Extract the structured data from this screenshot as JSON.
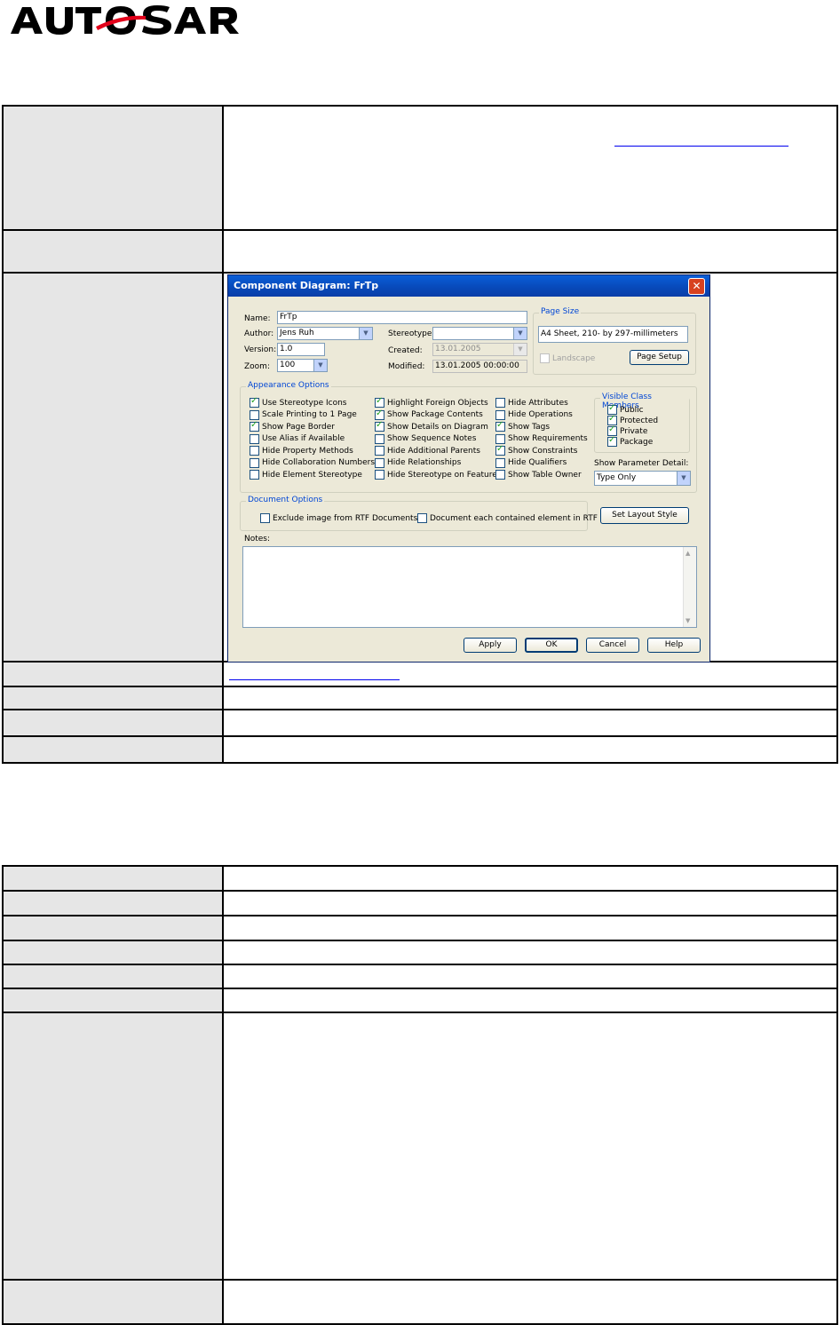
{
  "logo": {
    "text": "AUTOSAR"
  },
  "table1": {
    "row1_link": "",
    "row2_text": "",
    "row4_link": ""
  },
  "dialog": {
    "title": "Component Diagram: FrTp",
    "name_label": "Name:",
    "name_value": "FrTp",
    "author_label": "Author:",
    "author_value": "Jens Ruh",
    "version_label": "Version:",
    "version_value": "1.0",
    "zoom_label": "Zoom:",
    "zoom_value": "100",
    "stereotype_label": "Stereotype:",
    "stereotype_value": "",
    "created_label": "Created:",
    "created_value": "13.01.2005",
    "modified_label": "Modified:",
    "modified_value": "13.01.2005 00:00:00",
    "page_size": {
      "title": "Page Size",
      "value": "A4 Sheet, 210- by 297-millimeters",
      "landscape_label": "Landscape",
      "page_setup_button": "Page Setup"
    },
    "appearance": {
      "title": "Appearance Options",
      "col1": [
        {
          "label": "Use Stereotype Icons",
          "checked": true
        },
        {
          "label": "Scale Printing to 1 Page",
          "checked": false
        },
        {
          "label": "Show Page Border",
          "checked": true
        },
        {
          "label": "Use Alias if Available",
          "checked": false
        },
        {
          "label": "Hide Property Methods",
          "checked": false
        },
        {
          "label": "Hide Collaboration Numbers",
          "checked": false
        },
        {
          "label": "Hide Element Stereotype",
          "checked": false
        }
      ],
      "col2": [
        {
          "label": "Highlight Foreign Objects",
          "checked": true
        },
        {
          "label": "Show Package Contents",
          "checked": true
        },
        {
          "label": "Show Details on Diagram",
          "checked": true
        },
        {
          "label": "Show Sequence Notes",
          "checked": false
        },
        {
          "label": "Hide Additional Parents",
          "checked": false
        },
        {
          "label": "Hide Relationships",
          "checked": false
        },
        {
          "label": "Hide Stereotype on Features",
          "checked": false
        }
      ],
      "col3": [
        {
          "label": "Hide Attributes",
          "checked": false
        },
        {
          "label": "Hide Operations",
          "checked": false
        },
        {
          "label": "Show Tags",
          "checked": true
        },
        {
          "label": "Show Requirements",
          "checked": false
        },
        {
          "label": "Show Constraints",
          "checked": true
        },
        {
          "label": "Hide Qualifiers",
          "checked": false
        },
        {
          "label": "Show Table Owner",
          "checked": false
        }
      ],
      "visible_members": {
        "title": "Visible Class Members",
        "items": [
          {
            "label": "Public",
            "checked": true
          },
          {
            "label": "Protected",
            "checked": true
          },
          {
            "label": "Private",
            "checked": true
          },
          {
            "label": "Package",
            "checked": true
          }
        ]
      },
      "param_detail_label": "Show Parameter Detail:",
      "param_detail_value": "Type Only"
    },
    "document_options": {
      "title": "Document Options",
      "exclude_label": "Exclude image from RTF Documents",
      "each_label": "Document each contained element in RTF"
    },
    "set_layout_button": "Set Layout Style",
    "notes_label": "Notes:",
    "buttons": {
      "apply": "Apply",
      "ok": "OK",
      "cancel": "Cancel",
      "help": "Help"
    }
  }
}
